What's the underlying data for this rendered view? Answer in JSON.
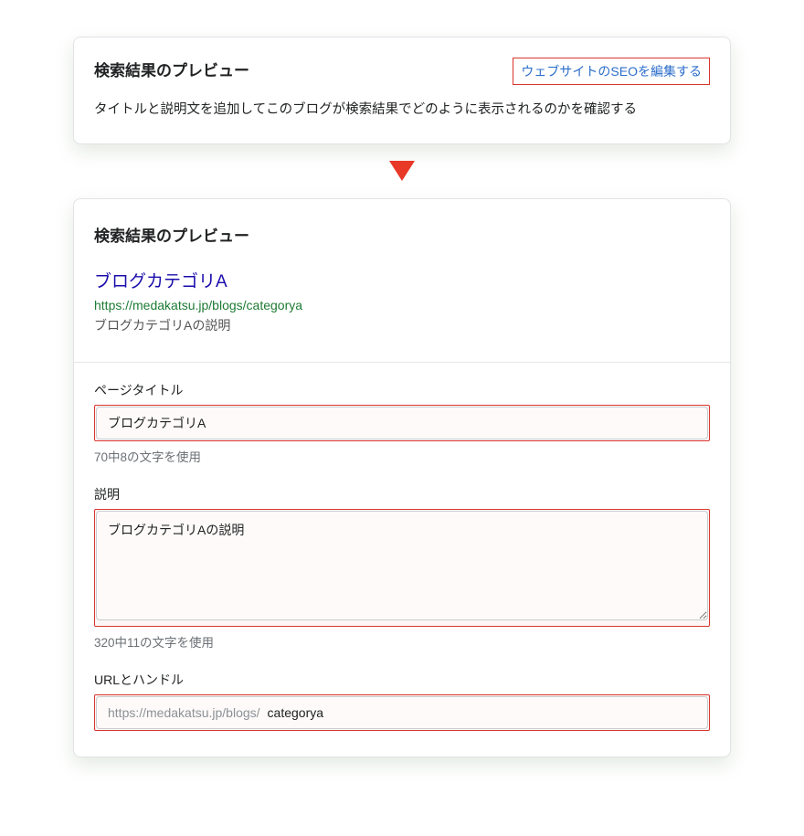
{
  "top_card": {
    "title": "検索結果のプレビュー",
    "edit_link": "ウェブサイトのSEOを編集する",
    "description": "タイトルと説明文を追加してこのブログが検索結果でどのように表示されるのかを確認する"
  },
  "bottom_card": {
    "title": "検索結果のプレビュー",
    "preview": {
      "title": "ブログカテゴリA",
      "url": "https://medakatsu.jp/blogs/categorya",
      "description": "ブログカテゴリAの説明"
    },
    "form": {
      "page_title": {
        "label": "ページタイトル",
        "value": "ブログカテゴリA",
        "help": "70中8の文字を使用"
      },
      "description": {
        "label": "説明",
        "value": "ブログカテゴリAの説明",
        "help": "320中11の文字を使用"
      },
      "url_handle": {
        "label": "URLとハンドル",
        "prefix": "https://medakatsu.jp/blogs/",
        "value": "categorya"
      }
    }
  }
}
